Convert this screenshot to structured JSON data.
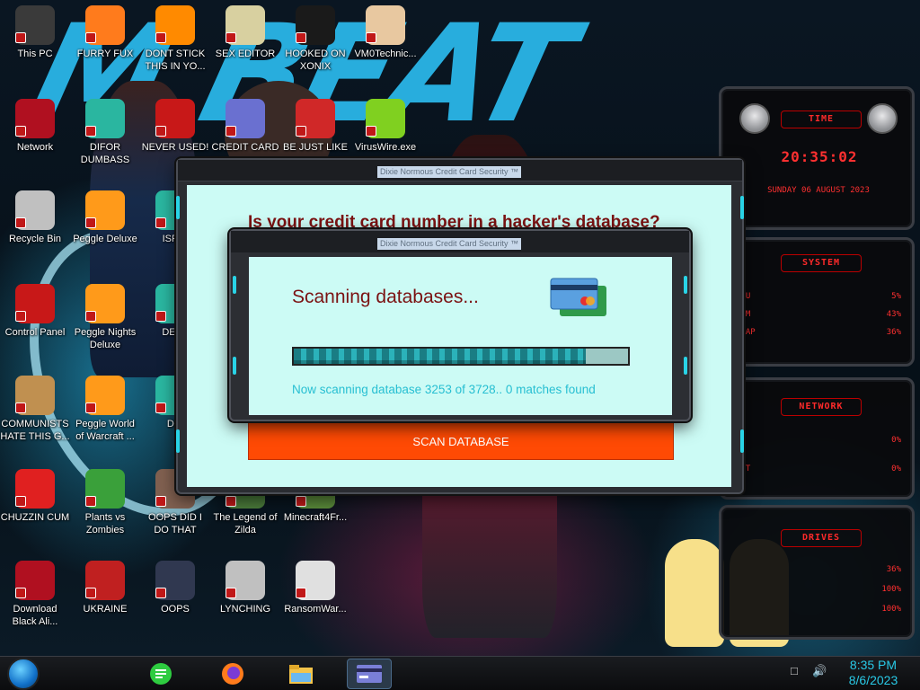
{
  "desktop_icons": [
    {
      "label": "This PC",
      "icon": "computer-icon"
    },
    {
      "label": "FURRY FUX",
      "icon": "firefox-icon"
    },
    {
      "label": "DONT STICK THIS IN YO...",
      "icon": "vlc-cone-icon"
    },
    {
      "label": "SEX EDITOR",
      "icon": "hxd-icon"
    },
    {
      "label": "HOOKED ON XONIX",
      "icon": "xonix-icon"
    },
    {
      "label": "VM0Technic...",
      "icon": "doctor-icon"
    },
    {
      "label": "Network",
      "icon": "network-icon"
    },
    {
      "label": "DIFOR DUMBASS",
      "icon": "app-icon"
    },
    {
      "label": "NEVER USED!",
      "icon": "dev-icon"
    },
    {
      "label": "CREDIT CARD",
      "icon": "credit-card-icon"
    },
    {
      "label": "BE JUST LIKE",
      "icon": "santa-icon"
    },
    {
      "label": "VirusWire.exe",
      "icon": "lime-icon"
    },
    {
      "label": "Recycle Bin",
      "icon": "recycle-bin-icon"
    },
    {
      "label": "Peggle Deluxe",
      "icon": "peggle-icon"
    },
    {
      "label": "ISRAI",
      "icon": "app-icon"
    },
    {
      "label": "Control Panel",
      "icon": "control-panel-icon"
    },
    {
      "label": "Peggle Nights Deluxe",
      "icon": "peggle-icon"
    },
    {
      "label": "DEEZ",
      "icon": "app-icon"
    },
    {
      "label": "COMMUNISTS HATE THIS G...",
      "icon": "money-bag-icon"
    },
    {
      "label": "Peggle World of Warcraft ...",
      "icon": "peggle-icon"
    },
    {
      "label": "DIE",
      "icon": "app-icon"
    },
    {
      "label": "CHUZZIN CUM",
      "icon": "chuzzle-icon"
    },
    {
      "label": "Plants vs Zombies",
      "icon": "plant-icon"
    },
    {
      "label": "OOPS DID I DO THAT",
      "icon": "face-icon"
    },
    {
      "label": "The Legend of Zilda",
      "icon": "zelda-icon"
    },
    {
      "label": "Minecraft4Fr...",
      "icon": "minecraft-icon"
    },
    {
      "label": "Download Black Ali...",
      "icon": "network-icon"
    },
    {
      "label": "UKRAINE",
      "icon": "radiation-icon"
    },
    {
      "label": "OOPS",
      "icon": "monitor-icon"
    },
    {
      "label": "LYNCHING",
      "icon": "knot-icon"
    },
    {
      "label": "RansomWar...",
      "icon": "skull-icon"
    }
  ],
  "gadget": {
    "time_title": "TIME",
    "time_value": "20:35:02",
    "date_value": "SUNDAY 06 AUGUST 2023",
    "system_title": "SYSTEM",
    "system_rows": [
      {
        "label": "CPU",
        "value": "5%"
      },
      {
        "label": "RAM",
        "value": "43%"
      },
      {
        "label": "SWAP",
        "value": "36%"
      }
    ],
    "network_title": "NETWORK",
    "network_rows": [
      {
        "label": "IN",
        "value": "0%"
      },
      {
        "label": "OUT",
        "value": "0%"
      }
    ],
    "drives_title": "DRIVES",
    "drive_values": [
      "36%",
      "100%",
      "100%"
    ]
  },
  "back_dialog": {
    "title": "Dixie Normous Credit Card Security ™",
    "question": "Is your credit card number in a hacker's database?",
    "button_label": "SCAN DATABASE"
  },
  "front_dialog": {
    "title": "Dixie Normous Credit Card Security ™",
    "heading": "Scanning databases...",
    "progress_fraction": 0.873,
    "status": "Now scanning database 3253 of 3728.. 0 matches found"
  },
  "taskbar": {
    "apps": [
      "green-app-icon",
      "firefox-icon",
      "file-explorer-icon",
      "credit-card-app-icon"
    ],
    "time": "8:35 PM",
    "date": "8/6/2023"
  },
  "colors": {
    "dialog_bg": "#ccfbf5",
    "heading_red": "#7b1212",
    "button_orange": "#ff4a04",
    "status_cyan": "#27bfd2",
    "accent_cyan": "#29d3e6"
  }
}
